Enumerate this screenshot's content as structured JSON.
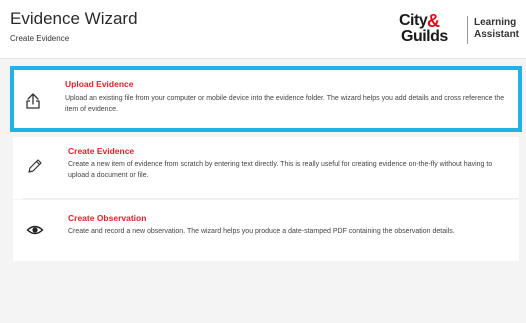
{
  "header": {
    "title": "Evidence Wizard",
    "subtitle": "Create Evidence",
    "logo": {
      "line1": "City",
      "ampersand": "&",
      "line2": "Guilds",
      "tagline_1": "Learning",
      "tagline_2": "Assistant"
    }
  },
  "options": [
    {
      "title": "Upload Evidence",
      "description": "Upload an existing file from your computer or mobile device into the evidence folder. The wizard helps you add details and cross reference the item of evidence.",
      "icon": "upload-icon",
      "selected": true
    },
    {
      "title": "Create Evidence",
      "description": "Create a new item of evidence from scratch by entering text directly. This is really useful for creating evidence on-the-fly without having to upload a document or file.",
      "icon": "pencil-icon",
      "selected": false
    },
    {
      "title": "Create Observation",
      "description": "Create and record a new observation. The wizard helps you produce a date-stamped PDF containing the observation details.",
      "icon": "eye-icon",
      "selected": false
    }
  ],
  "colors": {
    "accent_title": "#e0202b",
    "selection_border": "#1fb3e8",
    "brand_red": "#e30613"
  }
}
